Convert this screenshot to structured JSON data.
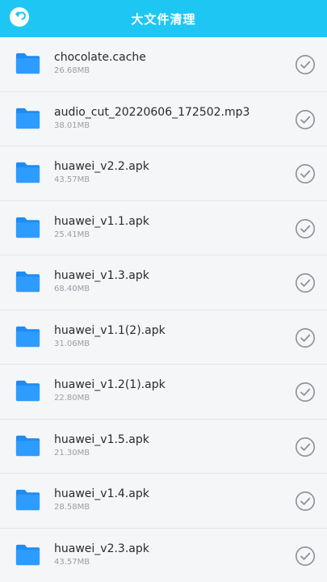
{
  "header": {
    "title": "大文件清理",
    "accent": "#1ec7f3"
  },
  "icons": {
    "back": "back-arrow-icon",
    "folder": "folder-icon",
    "check": "check-circle-icon"
  },
  "files": [
    {
      "name": "chocolate.cache",
      "size": "26.68MB"
    },
    {
      "name": "audio_cut_20220606_172502.mp3",
      "size": "38.01MB"
    },
    {
      "name": "huawei_v2.2.apk",
      "size": "43.57MB"
    },
    {
      "name": "huawei_v1.1.apk",
      "size": "25.41MB"
    },
    {
      "name": "huawei_v1.3.apk",
      "size": "68.40MB"
    },
    {
      "name": "huawei_v1.1(2).apk",
      "size": "31.06MB"
    },
    {
      "name": "huawei_v1.2(1).apk",
      "size": "22.80MB"
    },
    {
      "name": "huawei_v1.5.apk",
      "size": "21.30MB"
    },
    {
      "name": "huawei_v1.4.apk",
      "size": "28.58MB"
    },
    {
      "name": "huawei_v2.3.apk",
      "size": "43.57MB"
    }
  ]
}
